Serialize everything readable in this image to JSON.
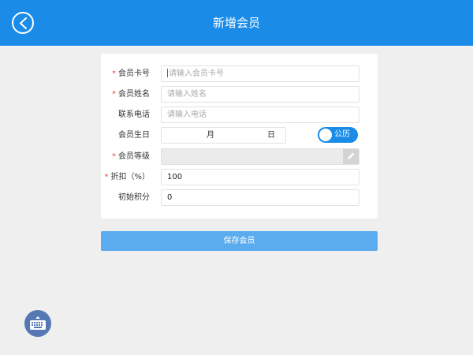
{
  "header": {
    "title": "新增会员"
  },
  "form": {
    "card_no": {
      "label": "会员卡号",
      "required": true,
      "placeholder": "请输入会员卡号"
    },
    "name": {
      "label": "会员姓名",
      "required": true,
      "placeholder": "请输入姓名"
    },
    "phone": {
      "label": "联系电话",
      "required": false,
      "placeholder": "请输入电话"
    },
    "birthday": {
      "label": "会员生日",
      "required": false,
      "month": "月",
      "day": "日",
      "calendar_toggle": "公历"
    },
    "level": {
      "label": "会员等级",
      "required": true,
      "value": ""
    },
    "discount": {
      "label": "折扣（%）",
      "required": true,
      "value": "100"
    },
    "points": {
      "label": "初始积分",
      "required": false,
      "value": "0"
    }
  },
  "required_mark": "*",
  "save_label": "保存会员",
  "icons": {
    "back": "chevron-left-icon",
    "edit": "pencil-icon",
    "keyboard": "keyboard-icon"
  },
  "colors": {
    "header": "#1a8ce8",
    "save_button": "#5aacef",
    "required_mark": "#e84c3d",
    "keyboard_button": "#5577b4"
  }
}
